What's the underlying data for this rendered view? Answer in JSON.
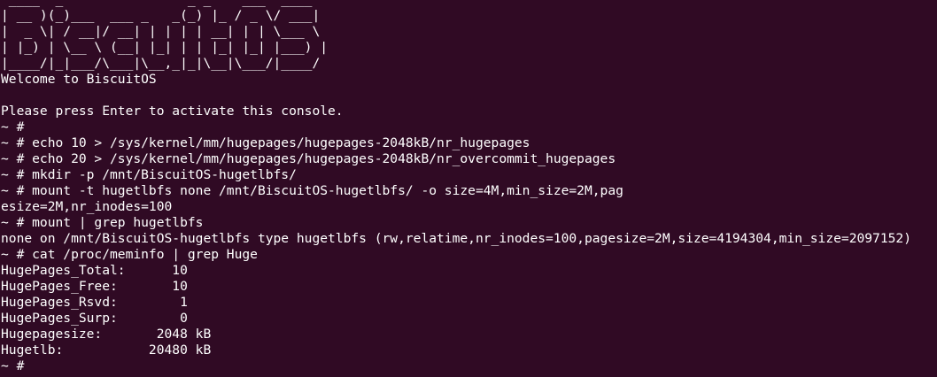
{
  "terminal": {
    "banner": [
      " ____  _                _ _    ___  ____",
      "| __ )(_)___  ___ _   _(_) |_ / _ \\/ ___|",
      "|  _ \\| / __|/ __| | | | | __| | | \\___ \\",
      "| |_) | \\__ \\ (__| |_| | | |_| |_| |___) |",
      "|____/|_|___/\\___|\\__,_|_|\\__|\\___/|____/"
    ],
    "lines": [
      "Welcome to BiscuitOS",
      "",
      "Please press Enter to activate this console.",
      "~ #",
      "~ # echo 10 > /sys/kernel/mm/hugepages/hugepages-2048kB/nr_hugepages",
      "~ # echo 20 > /sys/kernel/mm/hugepages/hugepages-2048kB/nr_overcommit_hugepages",
      "~ # mkdir -p /mnt/BiscuitOS-hugetlbfs/",
      "~ # mount -t hugetlbfs none /mnt/BiscuitOS-hugetlbfs/ -o size=4M,min_size=2M,pag",
      "esize=2M,nr_inodes=100",
      "~ # mount | grep hugetlbfs",
      "none on /mnt/BiscuitOS-hugetlbfs type hugetlbfs (rw,relatime,nr_inodes=100,pagesize=2M,size=4194304,min_size=2097152)",
      "~ # cat /proc/meminfo | grep Huge",
      "HugePages_Total:      10",
      "HugePages_Free:       10",
      "HugePages_Rsvd:        1",
      "HugePages_Surp:        0",
      "Hugepagesize:       2048 kB",
      "Hugetlb:           20480 kB"
    ],
    "prompt": "~ # "
  }
}
